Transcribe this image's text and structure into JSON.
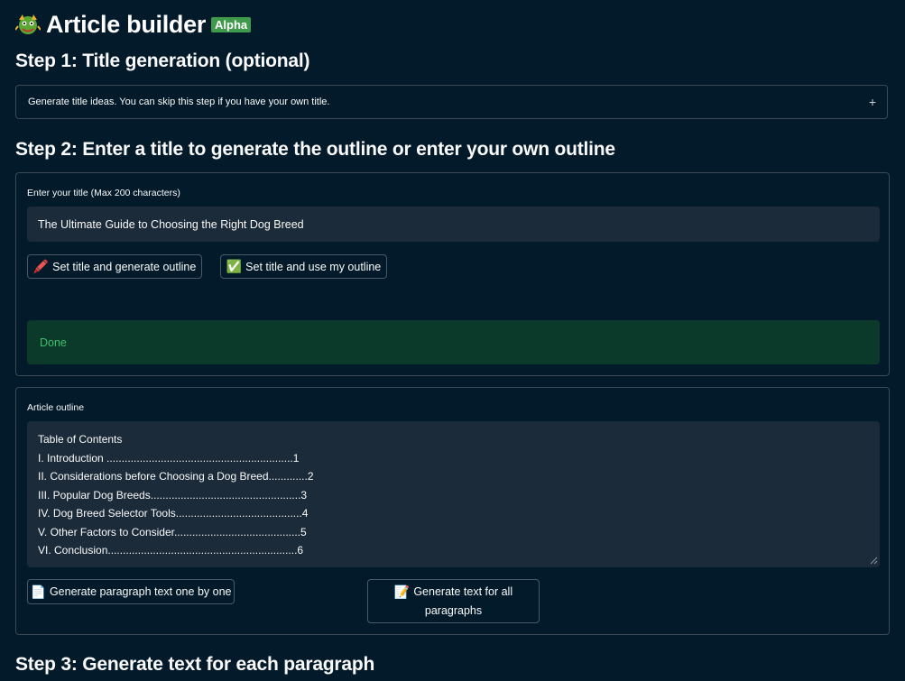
{
  "app": {
    "title": "Article builder",
    "badge": "Alpha",
    "logo_icon": "dragon-icon"
  },
  "step1": {
    "heading": "Step 1: Title generation (optional)",
    "expander_label": "Generate title ideas. You can skip this step if you have your own title.",
    "expander_icon": "+"
  },
  "step2": {
    "heading": "Step 2: Enter a title to generate the outline or enter your own outline",
    "title_label": "Enter your title (Max 200 characters)",
    "title_value": "The Ultimate Guide to Choosing the Right Dog Breed",
    "btn_generate_outline": "Set title and generate outline",
    "btn_generate_outline_icon": "🖍️",
    "btn_use_outline": "Set title and use my outline",
    "btn_use_outline_icon": "✅",
    "status": "Done",
    "outline_label": "Article outline",
    "outline_lines": [
      "Table of Contents",
      "I. Introduction ..............................................................1",
      "II. Considerations before Choosing a Dog Breed.............2",
      "III. Popular Dog Breeds..................................................3",
      "IV. Dog Breed Selector Tools..........................................4",
      "V. Other Factors to Consider..........................................5",
      "VI. Conclusion...............................................................6"
    ],
    "btn_one_by_one": "Generate paragraph text one by one",
    "btn_one_by_one_icon": "📄",
    "btn_all_line1": "Generate text for all",
    "btn_all_line2": "paragraphs",
    "btn_all_icon": "📝"
  },
  "step3": {
    "heading": "Step 3: Generate text for each paragraph"
  },
  "colors": {
    "background": "#031a2a",
    "badge": "#3f9a4b",
    "success_bg": "#0b3a2b",
    "success_text": "#3cbf6b",
    "input_bg": "#1c2b3a"
  }
}
